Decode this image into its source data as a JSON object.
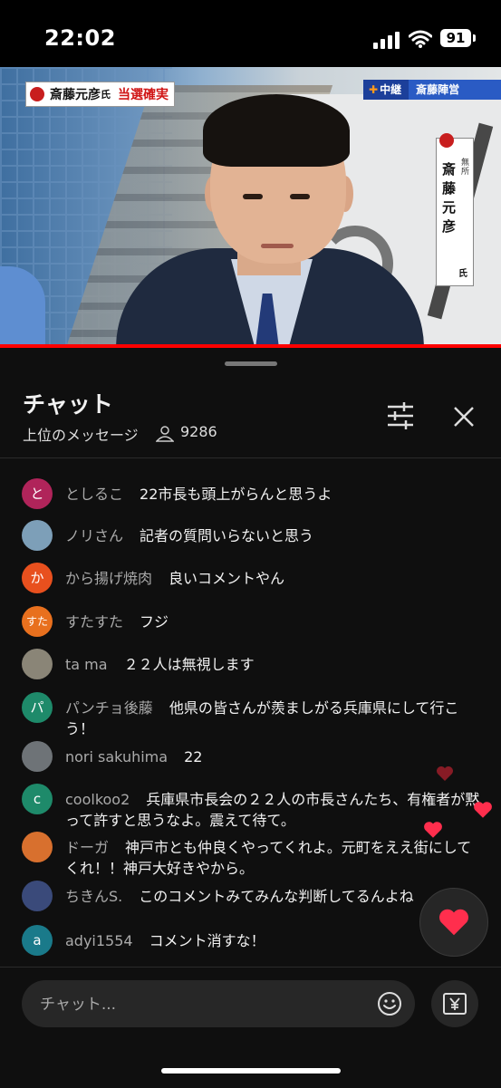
{
  "status_bar": {
    "time": "22:02",
    "battery": "91"
  },
  "video": {
    "banner_name": "斎藤元彦",
    "banner_honorific": "氏",
    "banner_status": "当選確実",
    "live_label": "中継",
    "live_location": "斎藤陣営",
    "vertical_name": "斎藤元彦",
    "vertical_honorific": "氏",
    "vertical_party": "無所",
    "progress": 1.0
  },
  "chat": {
    "title": "チャット",
    "subtitle": "上位のメッセージ",
    "viewer_count": "9286",
    "input_placeholder": "チャット...",
    "messages": [
      {
        "author": "としるこ",
        "avatar_text": "と",
        "avatar_color": "#b0245a",
        "text": "22市長も頭上がらんと思うよ"
      },
      {
        "author": "ノリさん",
        "avatar_text": "",
        "avatar_color": "#7d9fb8",
        "text": "記者の質問いらないと思う"
      },
      {
        "author": "から揚げ焼肉",
        "avatar_text": "か",
        "avatar_color": "#e8501e",
        "text": "良いコメントやん"
      },
      {
        "author": "すたすた",
        "avatar_text": "すた",
        "avatar_color": "#e8701e",
        "text": "フジ"
      },
      {
        "author": "ta ma",
        "avatar_text": "",
        "avatar_color": "#8a8577",
        "text": "２２人は無視します"
      },
      {
        "author": "パンチョ後藤",
        "avatar_text": "パ",
        "avatar_color": "#1e8a6a",
        "text": "他県の皆さんが羨ましがる兵庫県にして行こう！"
      },
      {
        "author": "nori sakuhima",
        "avatar_text": "",
        "avatar_color": "#6e7377",
        "text": "22"
      },
      {
        "author": "coolkoo2",
        "avatar_text": "c",
        "avatar_color": "#1e8a6a",
        "text": "兵庫県市長会の２２人の市長さんたち、有権者が黙って許すと思うなよ。震えて待て。"
      },
      {
        "author": "ドーガ",
        "avatar_text": "",
        "avatar_color": "#d8702e",
        "text": "神戸市とも仲良くやってくれよ。元町をええ街にしてくれ！！神戸大好きやから。"
      },
      {
        "author": "ちきんS.",
        "avatar_text": "",
        "avatar_color": "#3a4a7a",
        "text": "このコメントみてみんな判断してるんよね"
      },
      {
        "author": "adyi1554",
        "avatar_text": "a",
        "avatar_color": "#1a7a8a",
        "text": "コメント消すな！"
      }
    ]
  },
  "colors": {
    "accent_heart": "#ff2e4d",
    "progress": "#ff0000",
    "background": "#0f0f0f"
  },
  "icons": [
    "signal-icon",
    "wifi-icon",
    "battery-icon",
    "person-icon",
    "sliders-icon",
    "close-icon",
    "heart-icon",
    "emoji-icon",
    "yen-icon"
  ]
}
